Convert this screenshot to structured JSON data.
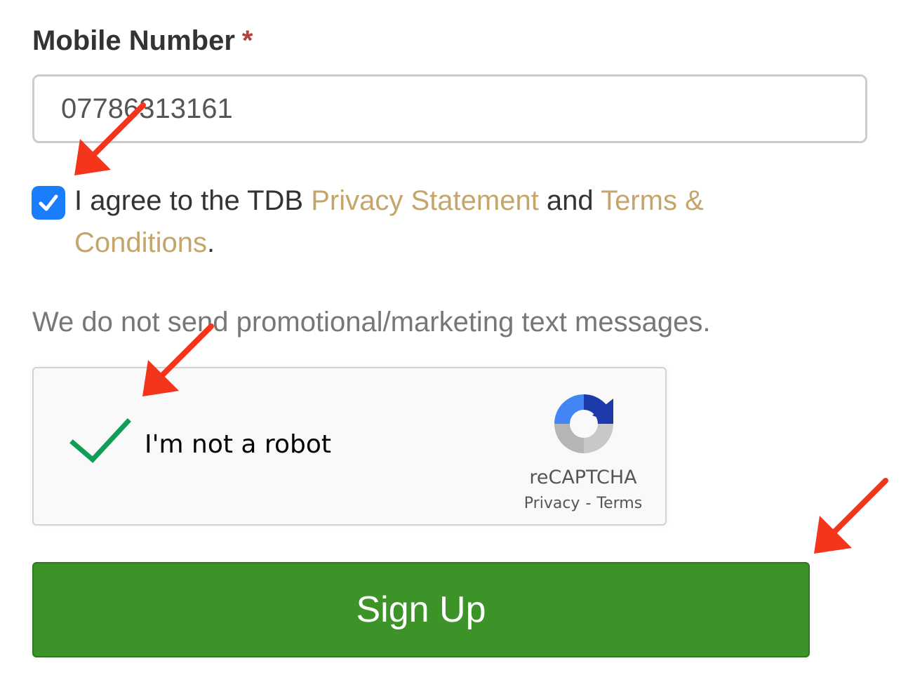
{
  "mobile": {
    "label": "Mobile Number",
    "required_marker": "*",
    "value": "07786313161"
  },
  "agreement": {
    "checked": true,
    "prefix": "I agree to the TDB ",
    "privacy_link": "Privacy Statement",
    "middle": " and ",
    "terms_link": "Terms & Conditions",
    "suffix": "."
  },
  "note": "We do not send promotional/marketing text messages.",
  "recaptcha": {
    "label": "I'm not a robot",
    "brand": "reCAPTCHA",
    "privacy": "Privacy",
    "separator": "-",
    "terms": "Terms",
    "checked": true
  },
  "signup_button": "Sign Up",
  "colors": {
    "link": "#c4a56b",
    "checkbox": "#1a7dfb",
    "button": "#3c9429",
    "required": "#b0413e",
    "arrow": "#f4351b",
    "captcha_check": "#0f9d58"
  },
  "icons": {
    "agree_checkbox": "checkmark-icon",
    "captcha_check": "green-checkmark-icon",
    "captcha_logo": "recaptcha-logo-icon",
    "annotation": "red-arrow-icon"
  }
}
